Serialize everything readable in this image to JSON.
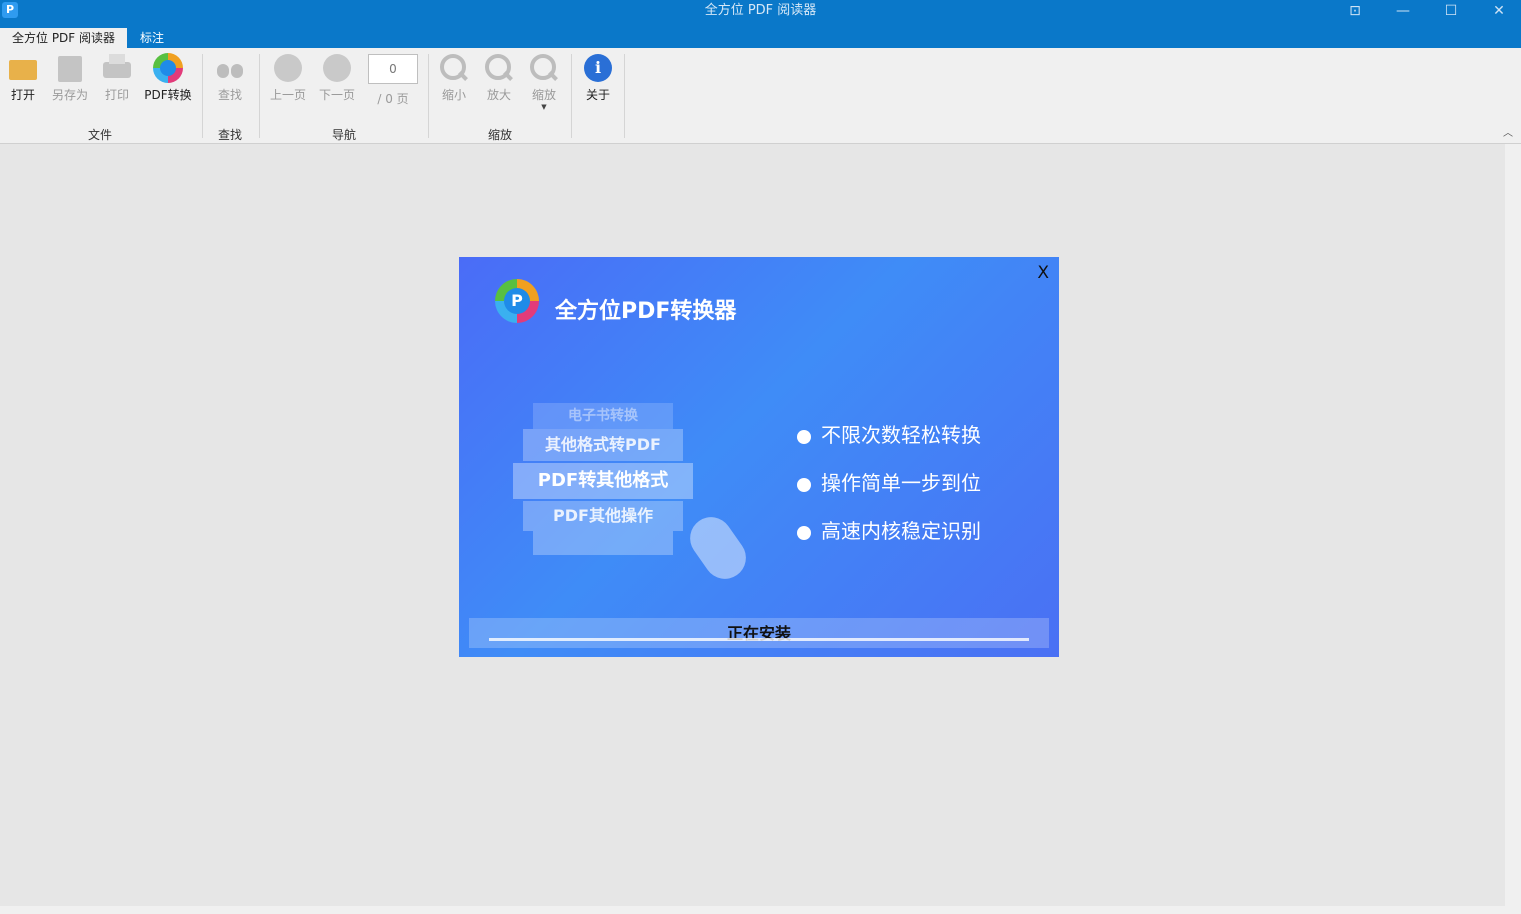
{
  "window": {
    "app_icon": "P",
    "title": "全方位 PDF 阅读器",
    "controls": [
      "⊡",
      "—",
      "☐",
      "✕"
    ]
  },
  "tabs": [
    {
      "label": "全方位 PDF 阅读器",
      "active": true
    },
    {
      "label": "标注",
      "active": false
    }
  ],
  "ribbon": {
    "file": {
      "group": "文件",
      "open": "打开",
      "save_as": "另存为",
      "print": "打印",
      "pdf_convert": "PDF转换"
    },
    "find": {
      "group": "查找",
      "find": "查找"
    },
    "nav": {
      "group": "导航",
      "prev": "上一页",
      "next": "下一页",
      "page_value": "0",
      "page_total": "/ 0 页"
    },
    "zoom": {
      "group": "缩放",
      "zoom_out": "缩小",
      "zoom_in": "放大",
      "zoom": "缩放"
    },
    "about": "关于"
  },
  "dialog": {
    "title": "全方位PDF转换器",
    "close": "X",
    "cards": [
      "电子书转换",
      "其他格式转PDF",
      "PDF转其他格式",
      "PDF其他操作"
    ],
    "features": [
      "不限次数轻松转换",
      "操作简单一步到位",
      "高速内核稳定识别"
    ],
    "progress_label": "正在安装",
    "colors": {
      "accent": "#4a6cf7",
      "titlebar": "#0a78c9"
    }
  }
}
